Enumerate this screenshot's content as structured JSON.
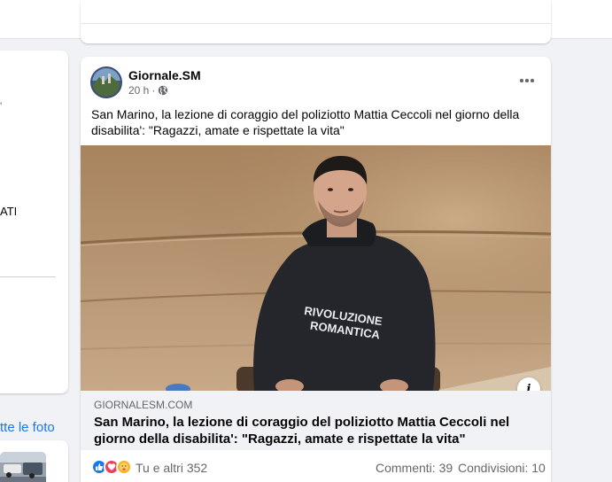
{
  "top_bar": {
    "more_icon": "more-horizontal-icon"
  },
  "left_panel": {
    "fragment_1": "'",
    "fragment_2": "ATI",
    "photos_link": "tte le foto"
  },
  "post": {
    "page_name": "Giornale.SM",
    "time": "20 h",
    "privacy_icon": "globe-icon",
    "caption": "San Marino, la lezione di coraggio del poliziotto Mattia Ceccoli nel giorno della disabilita': \"Ragazzi, amate e rispettate la vita\"",
    "image_text": [
      "RIVOLUZIONE",
      "ROMANTICA"
    ],
    "link": {
      "domain": "GIORNALESM.COM",
      "title": "San Marino, la lezione di coraggio del poliziotto Mattia Ceccoli nel giorno della disabilita': \"Ragazzi, amate e rispettate la vita\""
    },
    "reactions": [
      "like",
      "love",
      "care"
    ],
    "reaction_count": "Tu e altri 352",
    "comments": "Commenti: 39",
    "shares": "Condivisioni: 10"
  },
  "colors": {
    "accent": "#1877f2",
    "background": "#f0f2f5",
    "secondary_text": "#65676b"
  }
}
